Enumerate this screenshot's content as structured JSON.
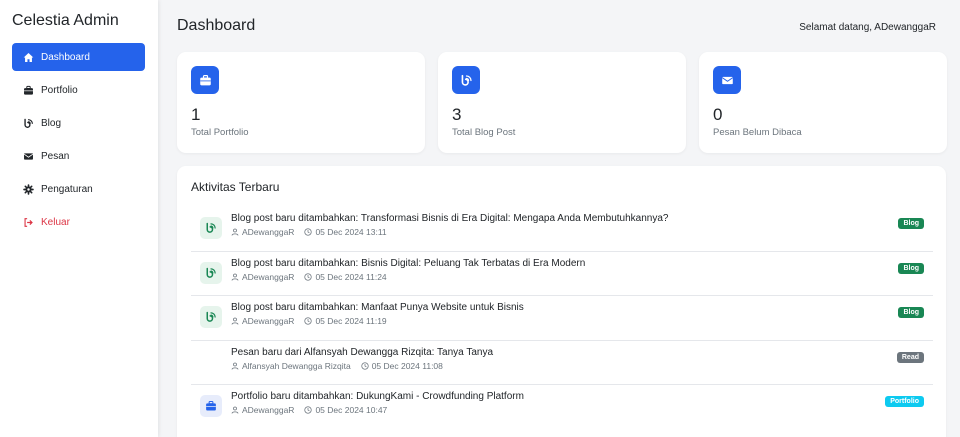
{
  "brand": "Celestia Admin",
  "nav": [
    {
      "label": "Dashboard",
      "icon": "home-icon",
      "active": true
    },
    {
      "label": "Portfolio",
      "icon": "briefcase-icon"
    },
    {
      "label": "Blog",
      "icon": "blog-icon"
    },
    {
      "label": "Pesan",
      "icon": "envelope-icon"
    },
    {
      "label": "Pengaturan",
      "icon": "gear-icon"
    },
    {
      "label": "Keluar",
      "icon": "logout-icon",
      "danger": true
    }
  ],
  "header": {
    "title": "Dashboard",
    "welcome": "Selamat datang, ADewanggaR"
  },
  "stats": [
    {
      "value": "1",
      "label": "Total Portfolio",
      "icon": "briefcase-icon"
    },
    {
      "value": "3",
      "label": "Total Blog Post",
      "icon": "blog-icon"
    },
    {
      "value": "0",
      "label": "Pesan Belum Dibaca",
      "icon": "envelope-icon"
    }
  ],
  "activity": {
    "title": "Aktivitas Terbaru",
    "items": [
      {
        "text": "Blog post baru ditambahkan: Transformasi Bisnis di Era Digital: Mengapa Anda Membutuhkannya?",
        "user": "ADewanggaR",
        "time": "05 Dec 2024 13:11",
        "badge": "Blog",
        "type": "blog"
      },
      {
        "text": "Blog post baru ditambahkan: Bisnis Digital: Peluang Tak Terbatas di Era Modern",
        "user": "ADewanggaR",
        "time": "05 Dec 2024 11:24",
        "badge": "Blog",
        "type": "blog"
      },
      {
        "text": "Blog post baru ditambahkan: Manfaat Punya Website untuk Bisnis",
        "user": "ADewanggaR",
        "time": "05 Dec 2024 11:19",
        "badge": "Blog",
        "type": "blog"
      },
      {
        "text": "Pesan baru dari Alfansyah Dewangga Rizqita: Tanya Tanya",
        "user": "Alfansyah Dewangga Rizqita",
        "time": "05 Dec 2024 11:08",
        "badge": "Read",
        "type": "read"
      },
      {
        "text": "Portfolio baru ditambahkan: DukungKami - Crowdfunding Platform",
        "user": "ADewanggaR",
        "time": "05 Dec 2024 10:47",
        "badge": "Portfolio",
        "type": "portfolio"
      }
    ]
  },
  "colors": {
    "accent": "#2563eb",
    "danger": "#dc3545",
    "badge_blog": "#198754",
    "badge_read": "#6c757d",
    "badge_portfolio": "#0dcaf0"
  }
}
